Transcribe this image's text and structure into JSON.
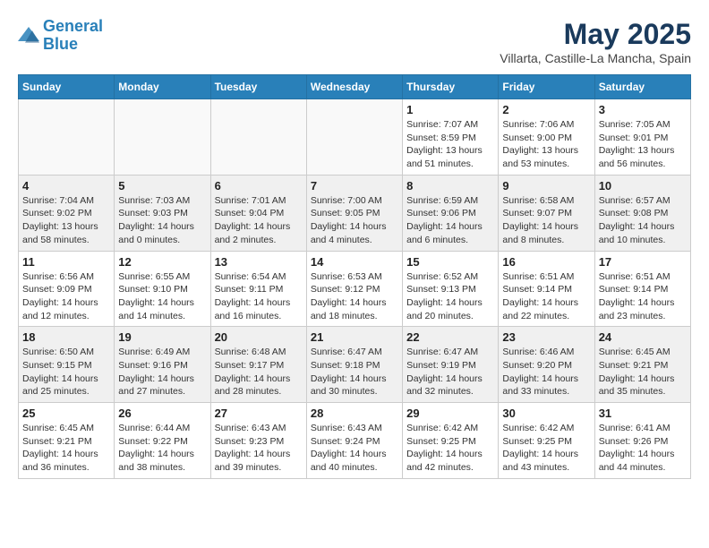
{
  "header": {
    "logo_line1": "General",
    "logo_line2": "Blue",
    "title": "May 2025",
    "subtitle": "Villarta, Castille-La Mancha, Spain"
  },
  "weekdays": [
    "Sunday",
    "Monday",
    "Tuesday",
    "Wednesday",
    "Thursday",
    "Friday",
    "Saturday"
  ],
  "weeks": [
    [
      {
        "day": "",
        "info": ""
      },
      {
        "day": "",
        "info": ""
      },
      {
        "day": "",
        "info": ""
      },
      {
        "day": "",
        "info": ""
      },
      {
        "day": "1",
        "info": "Sunrise: 7:07 AM\nSunset: 8:59 PM\nDaylight: 13 hours\nand 51 minutes."
      },
      {
        "day": "2",
        "info": "Sunrise: 7:06 AM\nSunset: 9:00 PM\nDaylight: 13 hours\nand 53 minutes."
      },
      {
        "day": "3",
        "info": "Sunrise: 7:05 AM\nSunset: 9:01 PM\nDaylight: 13 hours\nand 56 minutes."
      }
    ],
    [
      {
        "day": "4",
        "info": "Sunrise: 7:04 AM\nSunset: 9:02 PM\nDaylight: 13 hours\nand 58 minutes."
      },
      {
        "day": "5",
        "info": "Sunrise: 7:03 AM\nSunset: 9:03 PM\nDaylight: 14 hours\nand 0 minutes."
      },
      {
        "day": "6",
        "info": "Sunrise: 7:01 AM\nSunset: 9:04 PM\nDaylight: 14 hours\nand 2 minutes."
      },
      {
        "day": "7",
        "info": "Sunrise: 7:00 AM\nSunset: 9:05 PM\nDaylight: 14 hours\nand 4 minutes."
      },
      {
        "day": "8",
        "info": "Sunrise: 6:59 AM\nSunset: 9:06 PM\nDaylight: 14 hours\nand 6 minutes."
      },
      {
        "day": "9",
        "info": "Sunrise: 6:58 AM\nSunset: 9:07 PM\nDaylight: 14 hours\nand 8 minutes."
      },
      {
        "day": "10",
        "info": "Sunrise: 6:57 AM\nSunset: 9:08 PM\nDaylight: 14 hours\nand 10 minutes."
      }
    ],
    [
      {
        "day": "11",
        "info": "Sunrise: 6:56 AM\nSunset: 9:09 PM\nDaylight: 14 hours\nand 12 minutes."
      },
      {
        "day": "12",
        "info": "Sunrise: 6:55 AM\nSunset: 9:10 PM\nDaylight: 14 hours\nand 14 minutes."
      },
      {
        "day": "13",
        "info": "Sunrise: 6:54 AM\nSunset: 9:11 PM\nDaylight: 14 hours\nand 16 minutes."
      },
      {
        "day": "14",
        "info": "Sunrise: 6:53 AM\nSunset: 9:12 PM\nDaylight: 14 hours\nand 18 minutes."
      },
      {
        "day": "15",
        "info": "Sunrise: 6:52 AM\nSunset: 9:13 PM\nDaylight: 14 hours\nand 20 minutes."
      },
      {
        "day": "16",
        "info": "Sunrise: 6:51 AM\nSunset: 9:14 PM\nDaylight: 14 hours\nand 22 minutes."
      },
      {
        "day": "17",
        "info": "Sunrise: 6:51 AM\nSunset: 9:14 PM\nDaylight: 14 hours\nand 23 minutes."
      }
    ],
    [
      {
        "day": "18",
        "info": "Sunrise: 6:50 AM\nSunset: 9:15 PM\nDaylight: 14 hours\nand 25 minutes."
      },
      {
        "day": "19",
        "info": "Sunrise: 6:49 AM\nSunset: 9:16 PM\nDaylight: 14 hours\nand 27 minutes."
      },
      {
        "day": "20",
        "info": "Sunrise: 6:48 AM\nSunset: 9:17 PM\nDaylight: 14 hours\nand 28 minutes."
      },
      {
        "day": "21",
        "info": "Sunrise: 6:47 AM\nSunset: 9:18 PM\nDaylight: 14 hours\nand 30 minutes."
      },
      {
        "day": "22",
        "info": "Sunrise: 6:47 AM\nSunset: 9:19 PM\nDaylight: 14 hours\nand 32 minutes."
      },
      {
        "day": "23",
        "info": "Sunrise: 6:46 AM\nSunset: 9:20 PM\nDaylight: 14 hours\nand 33 minutes."
      },
      {
        "day": "24",
        "info": "Sunrise: 6:45 AM\nSunset: 9:21 PM\nDaylight: 14 hours\nand 35 minutes."
      }
    ],
    [
      {
        "day": "25",
        "info": "Sunrise: 6:45 AM\nSunset: 9:21 PM\nDaylight: 14 hours\nand 36 minutes."
      },
      {
        "day": "26",
        "info": "Sunrise: 6:44 AM\nSunset: 9:22 PM\nDaylight: 14 hours\nand 38 minutes."
      },
      {
        "day": "27",
        "info": "Sunrise: 6:43 AM\nSunset: 9:23 PM\nDaylight: 14 hours\nand 39 minutes."
      },
      {
        "day": "28",
        "info": "Sunrise: 6:43 AM\nSunset: 9:24 PM\nDaylight: 14 hours\nand 40 minutes."
      },
      {
        "day": "29",
        "info": "Sunrise: 6:42 AM\nSunset: 9:25 PM\nDaylight: 14 hours\nand 42 minutes."
      },
      {
        "day": "30",
        "info": "Sunrise: 6:42 AM\nSunset: 9:25 PM\nDaylight: 14 hours\nand 43 minutes."
      },
      {
        "day": "31",
        "info": "Sunrise: 6:41 AM\nSunset: 9:26 PM\nDaylight: 14 hours\nand 44 minutes."
      }
    ]
  ]
}
